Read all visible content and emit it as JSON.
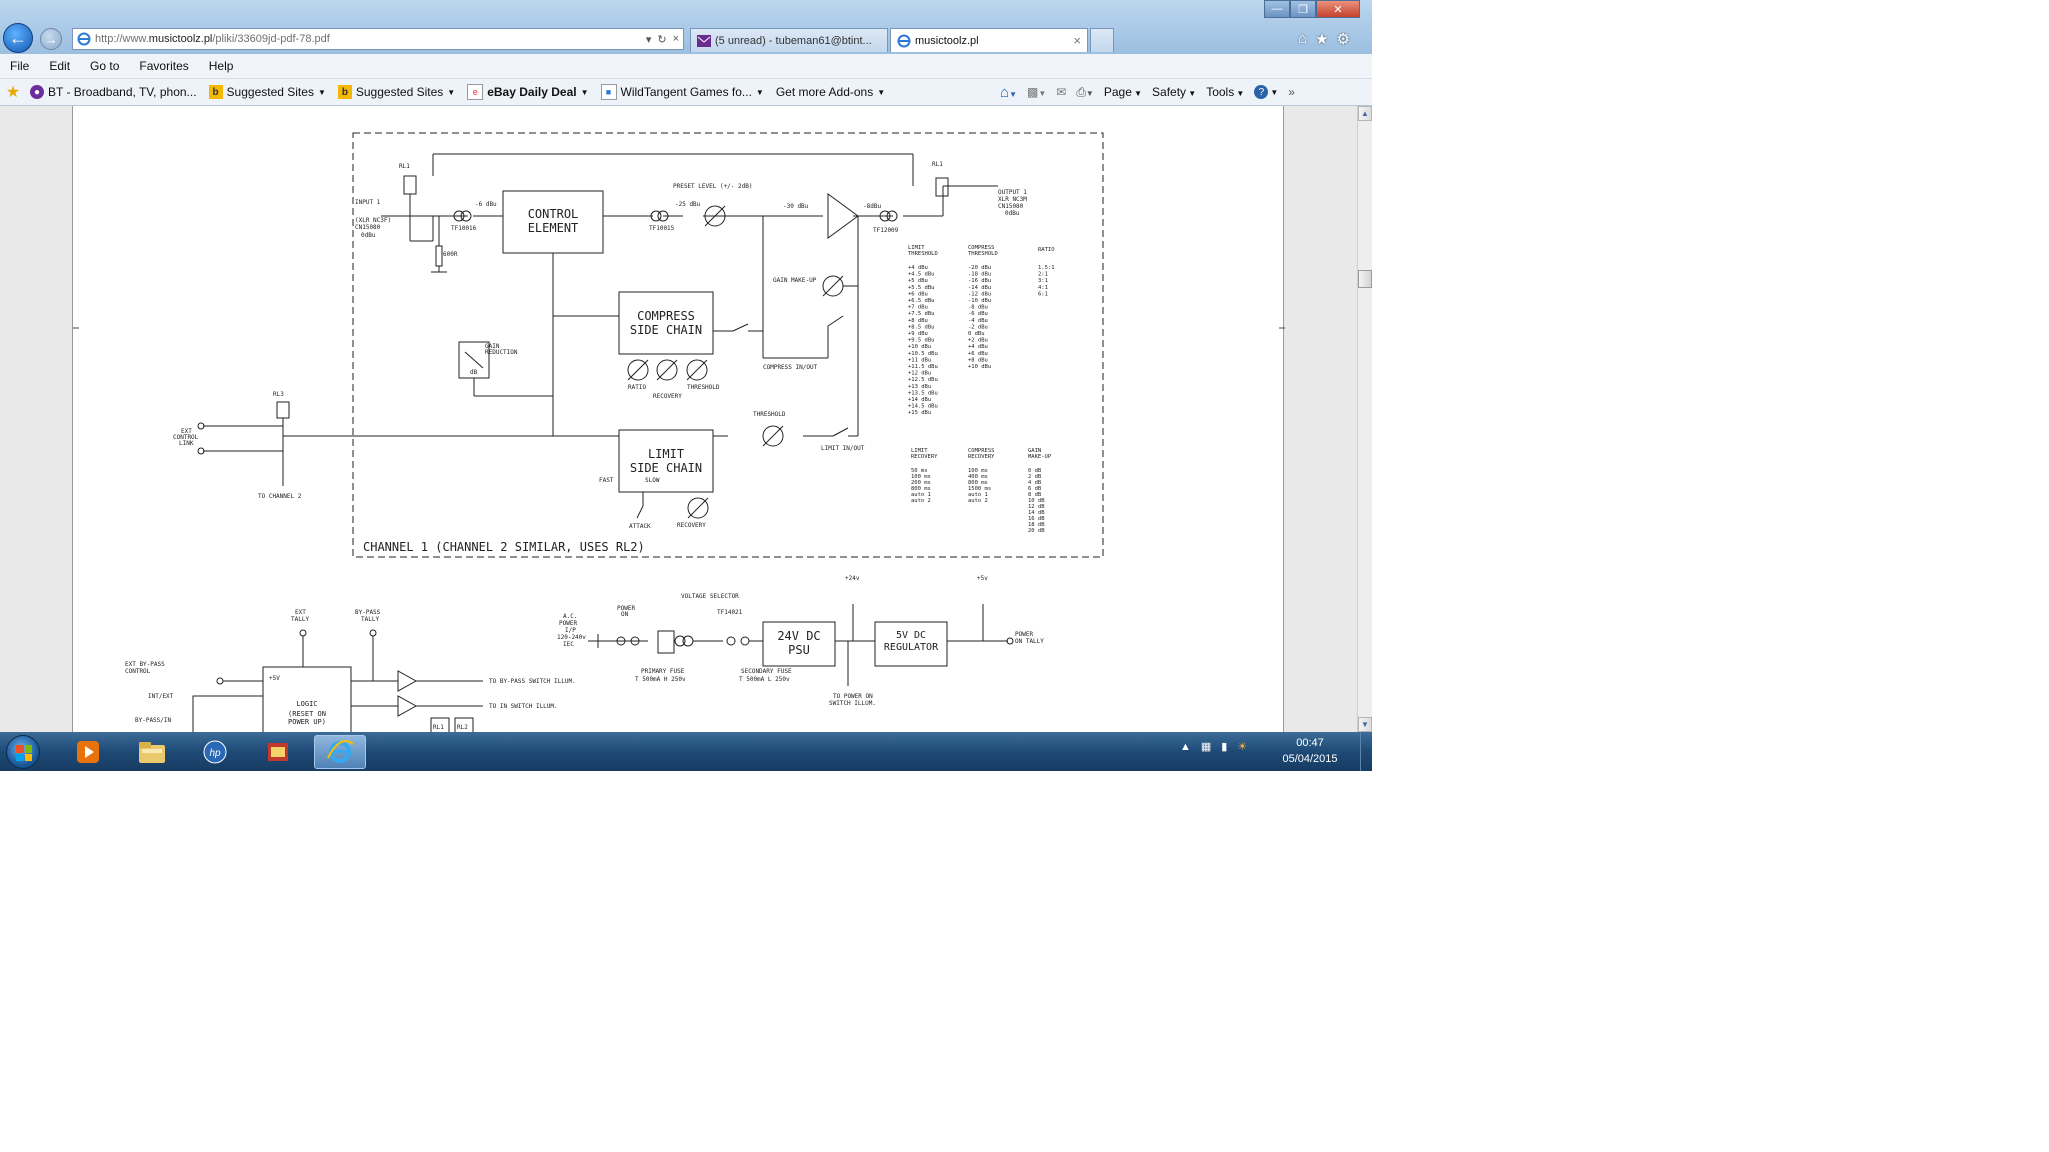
{
  "window": {
    "minimize_icon": "minimize-icon",
    "restore_icon": "restore-icon",
    "close_icon": "close-icon"
  },
  "address_bar": {
    "url_prefix": "http://www.",
    "url_domain": "musictoolz.pl",
    "url_path": "/pliki/33609jd-pdf-78.pdf"
  },
  "tabs": [
    {
      "label": "(5 unread) - tubeman61@btint...",
      "icon": "mail-icon"
    },
    {
      "label": "musictoolz.pl",
      "icon": "ie-page-icon"
    }
  ],
  "menu": [
    "File",
    "Edit",
    "Go to",
    "Favorites",
    "Help"
  ],
  "favorites": [
    {
      "label": "BT - Broadband, TV, phon...",
      "icon": "bt-icon",
      "dropdown": false
    },
    {
      "label": "Suggested Sites",
      "icon": "bing-icon",
      "dropdown": true
    },
    {
      "label": "Suggested Sites",
      "icon": "bing-icon",
      "dropdown": true
    },
    {
      "label": "eBay Daily Deal",
      "icon": "ebay-icon",
      "dropdown": true
    },
    {
      "label": "WildTangent Games fo...",
      "icon": "page-icon",
      "dropdown": true
    },
    {
      "label": "Get more Add-ons",
      "icon": "",
      "dropdown": true
    }
  ],
  "command_bar": {
    "page": "Page",
    "safety": "Safety",
    "tools": "Tools"
  },
  "schematic": {
    "channel_label": "CHANNEL 1 (CHANNEL 2 SIMILAR, USES RL2)",
    "blocks": {
      "control_element_1": "CONTROL",
      "control_element_2": "ELEMENT",
      "compress_1": "COMPRESS",
      "compress_2": "SIDE CHAIN",
      "limit_1": "LIMIT",
      "limit_2": "SIDE CHAIN",
      "psu24": "24V DC",
      "psu24_b": "PSU",
      "reg5_1": "5V DC",
      "reg5_2": "REGULATOR",
      "logic_1": "LOGIC",
      "logic_2": "(RESET ON",
      "logic_3": "POWER UP)"
    },
    "labels": {
      "rl1_in": "RL1",
      "rl1_out": "RL1",
      "rl3": "RL3",
      "input1": "INPUT 1",
      "xlr_in": "(XLR NC3F)",
      "cn_in": "CN15080",
      "dbu_in": "0dBu",
      "tf10016": "TF10016",
      "m6dbu": "-6 dBu",
      "preset": "PRESET LEVEL (+/- 2dB)",
      "m25": "-25 dBu",
      "tf10015": "TF10015",
      "m30": "-30 dBu",
      "m8": "-8dBu",
      "tf12009": "TF12009",
      "output1": "OUTPUT 1",
      "xlr_out": "XLR NC3M",
      "cn_out": "CN15080",
      "dbu_out": "0dBu",
      "r600": "600R",
      "gain_makeup": "GAIN MAKE-UP",
      "compress_inout": "COMPRESS IN/OUT",
      "gain_reduction_1": "GAIN",
      "gain_reduction_2": "REDUCTION",
      "db": "dB",
      "ratio": "RATIO",
      "recovery": "RECOVERY",
      "threshold": "THRESHOLD",
      "threshold2": "THRESHOLD",
      "limit_inout": "LIMIT IN/OUT",
      "fast": "FAST",
      "slow": "SLOW",
      "attack": "ATTACK",
      "recovery2": "RECOVERY",
      "ext_1": "EXT",
      "ext_2": "CONTROL",
      "ext_3": "LINK",
      "to_ch2": "TO CHANNEL 2",
      "ext_tally_1": "EXT",
      "ext_tally_2": "TALLY",
      "bypass_tally_1": "BY-PASS",
      "bypass_tally_2": "TALLY",
      "ext_bypass_1": "EXT BY-PASS",
      "ext_bypass_2": "CONTROL",
      "int_ext": "INT/EXT",
      "bypass_in": "BY-PASS/IN",
      "plus5v": "+5V",
      "to_bypass": "TO BY-PASS SWITCH ILLUM.",
      "to_in": "TO IN SWITCH ILLUM.",
      "rl1_small": "RL1",
      "rl2_small": "RL2",
      "ac_1": "A.C.",
      "ac_2": "POWER",
      "ac_3": "I/P",
      "ac_4": "120-240v",
      "ac_5": "IEC",
      "power_on_1": "POWER",
      "power_on_2": "ON",
      "voltage_sel": "VOLTAGE SELECTOR",
      "tf14021": "TF14021",
      "primary_1": "PRIMARY FUSE",
      "primary_2": "T 500mA H 250v",
      "secondary_1": "SECONDARY FUSE",
      "secondary_2": "T 500mA L 250v",
      "v24": "+24v",
      "v5": "+5v",
      "to_power_1": "TO POWER ON",
      "to_power_2": "SWITCH ILLUM.",
      "power_tally_1": "POWER",
      "power_tally_2": "ON TALLY"
    },
    "table1_headers": [
      "LIMIT THRESHOLD",
      "COMPRESS THRESHOLD",
      "RATIO"
    ],
    "table1_col1": [
      "+4 dBu",
      "+4.5 dBu",
      "+5 dBu",
      "+5.5 dBu",
      "+6 dBu",
      "+6.5 dBu",
      "+7 dBu",
      "+7.5 dBu",
      "+8 dBu",
      "+8.5 dBu",
      "+9 dBu",
      "+9.5 dBu",
      "+10 dBu",
      "+10.5 dBu",
      "+11 dBu",
      "+11.5 dBu",
      "+12 dBu",
      "+12.5 dBu",
      "+13 dBu",
      "+13.5 dBu",
      "+14 dBu",
      "+14.5 dBu",
      "+15 dBu"
    ],
    "table1_col2": [
      "-20 dBu",
      "-18 dBu",
      "-16 dBu",
      "-14 dBu",
      "-12 dBu",
      "-10 dBu",
      "-8 dBu",
      "-6 dBu",
      "-4 dBu",
      "-2 dBu",
      "0 dBu",
      "+2 dBu",
      "+4 dBu",
      "+6 dBu",
      "+8 dBu",
      "+10 dBu"
    ],
    "table1_col3": [
      "1.5:1",
      "2:1",
      "3:1",
      "4:1",
      "6:1"
    ],
    "table2_headers": [
      "LIMIT RECOVERY",
      "COMPRESS RECOVERY",
      "GAIN MAKE-UP"
    ],
    "table2_col1": [
      "50 ms",
      "100 ms",
      "200 ms",
      "800 ms",
      "auto 1",
      "auto 2"
    ],
    "table2_col2": [
      "100 ms",
      "400 ms",
      "800 ms",
      "1500 ms",
      "auto 1",
      "auto 2"
    ],
    "table2_col3": [
      "0 dB",
      "2 dB",
      "4 dB",
      "6 dB",
      "8 dB",
      "10 dB",
      "12 dB",
      "14 dB",
      "16 dB",
      "18 dB",
      "20 dB"
    ]
  },
  "taskbar": {
    "time": "00:47",
    "date": "05/04/2015"
  }
}
